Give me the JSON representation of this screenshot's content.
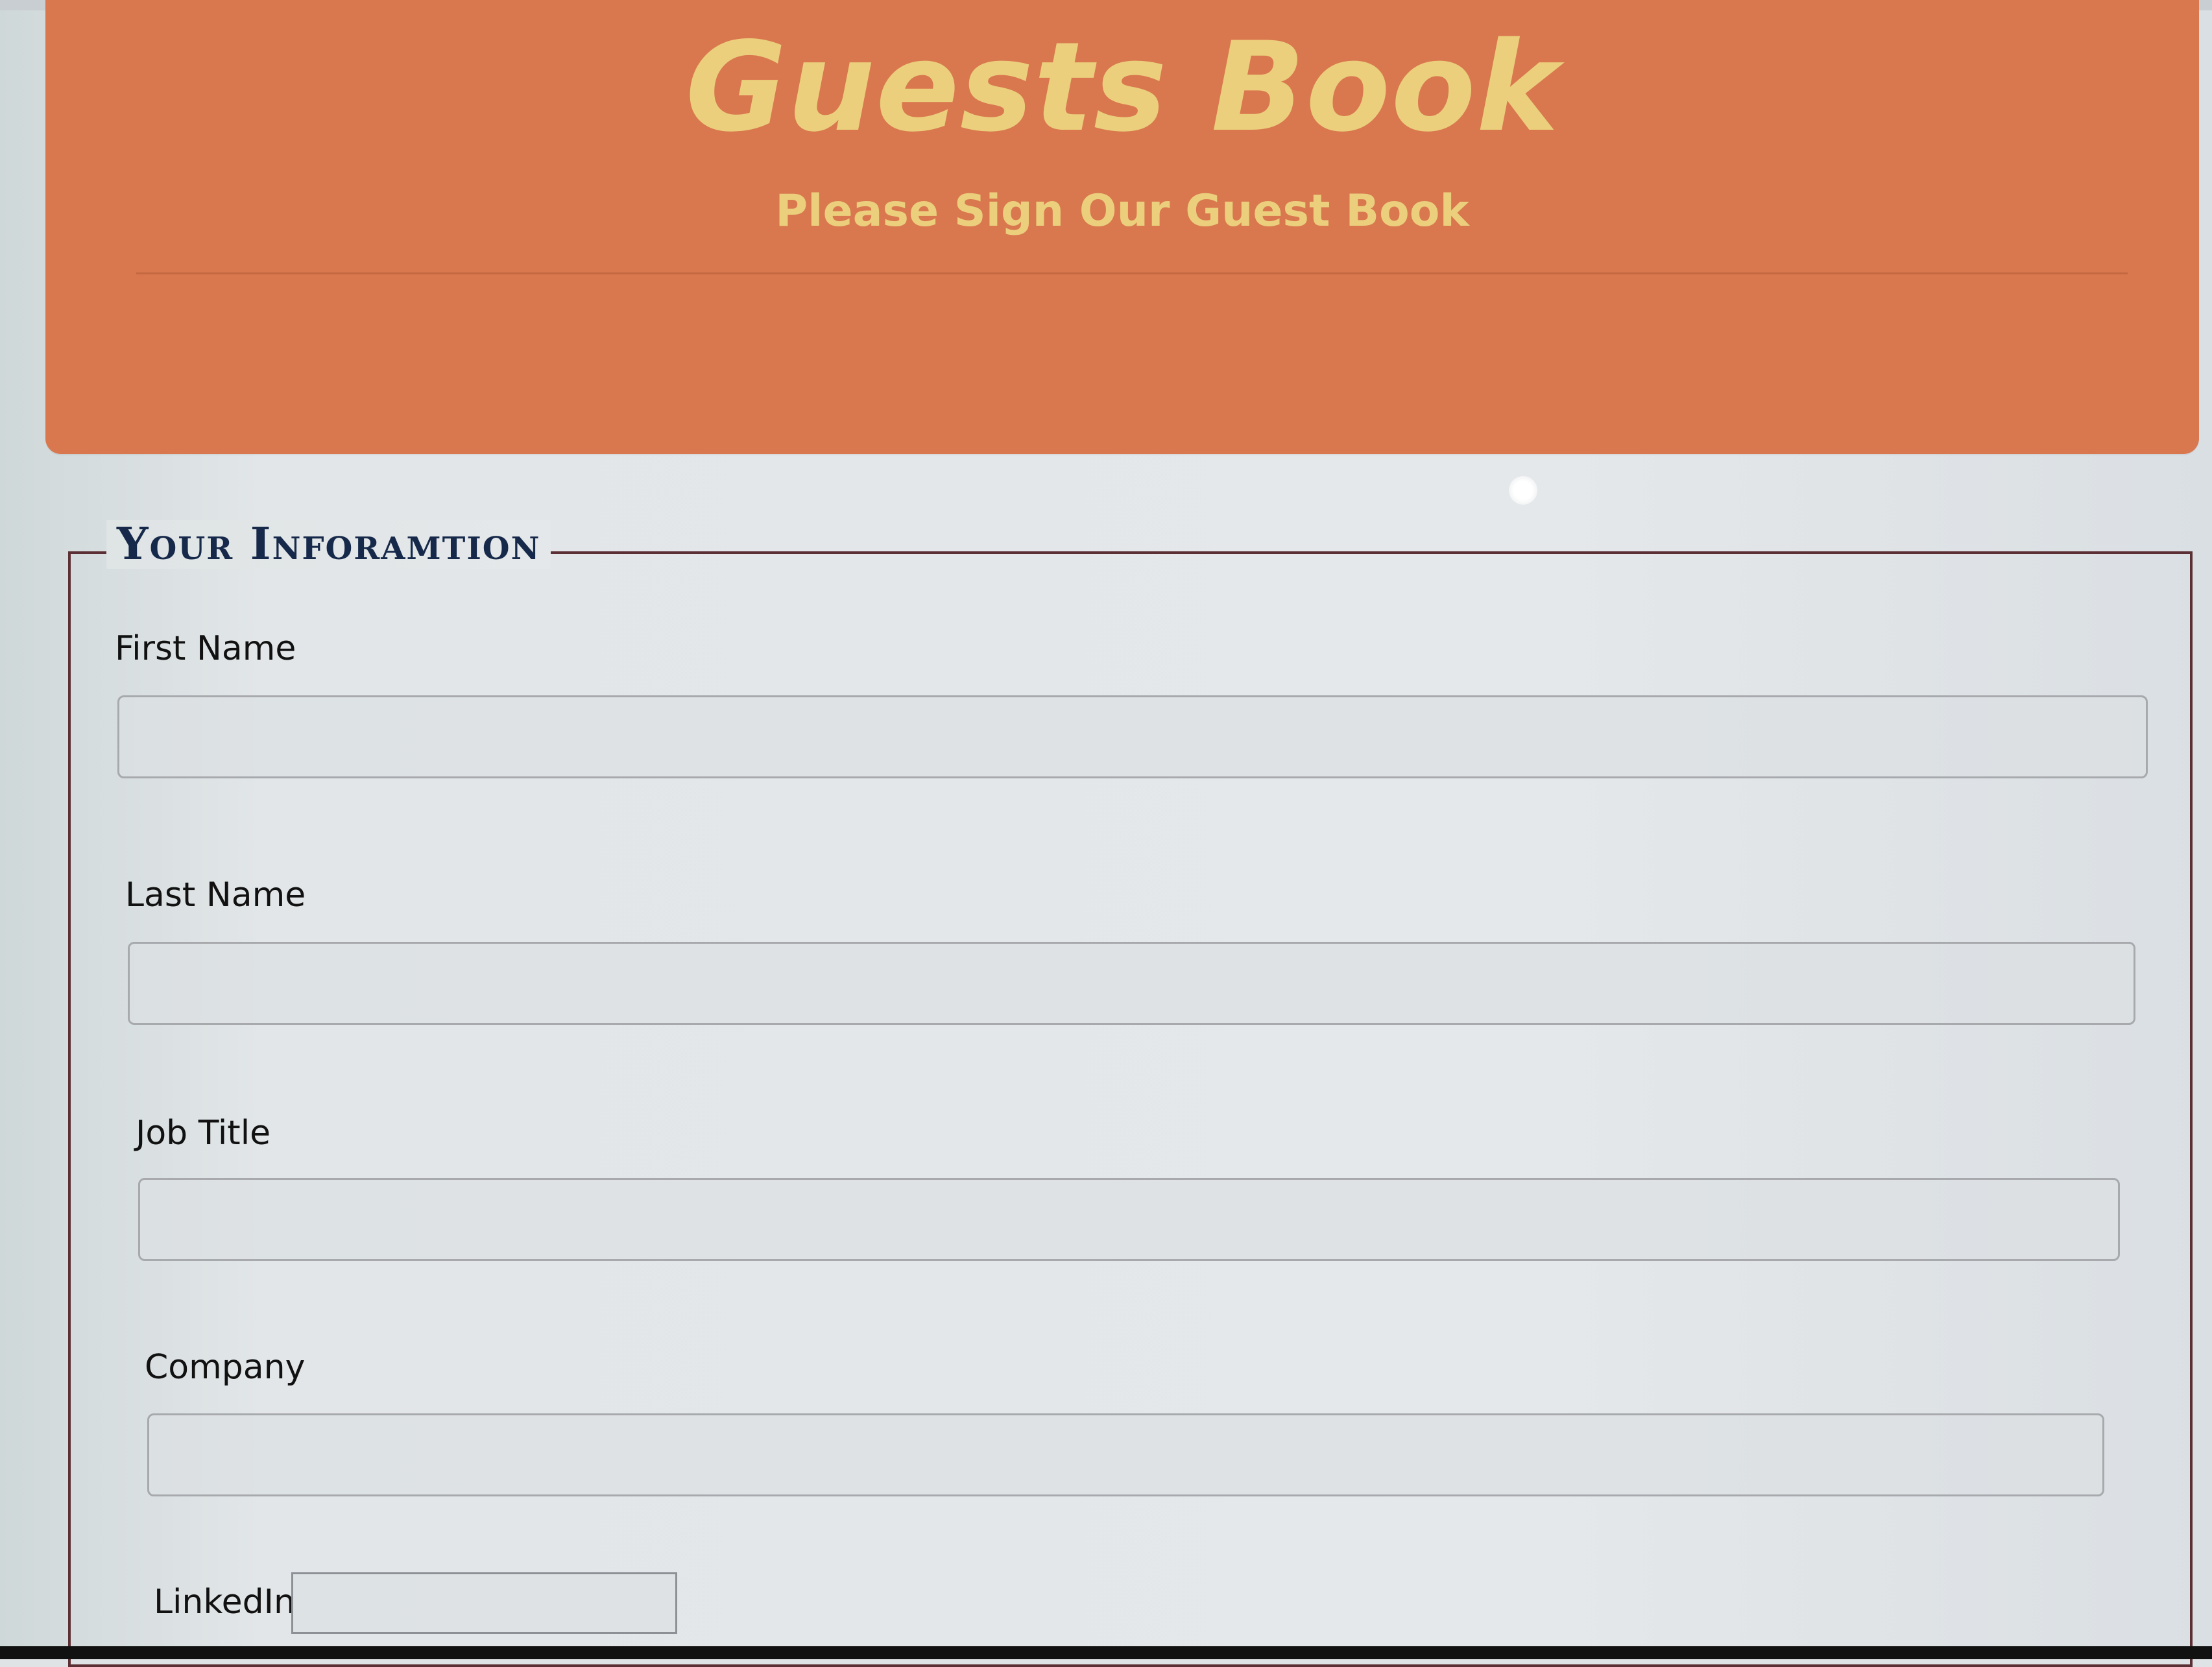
{
  "header": {
    "title": "Guests Book",
    "subtitle": "Please Sign Our Guest Book"
  },
  "form": {
    "section_title": "Your Inforamtion",
    "fields": {
      "first_name_label": "First Name",
      "last_name_label": "Last Name",
      "job_title_label": "Job Title",
      "company_label": "Company",
      "linkedin_label": "LinkedIn"
    },
    "values": {
      "first_name": "",
      "last_name": "",
      "job_title": "",
      "company": "",
      "linkedin": ""
    }
  },
  "colors": {
    "banner": "#d9784f",
    "banner_text": "#ebcf7c",
    "section_border": "#5b2f33",
    "section_title": "#16294a"
  }
}
